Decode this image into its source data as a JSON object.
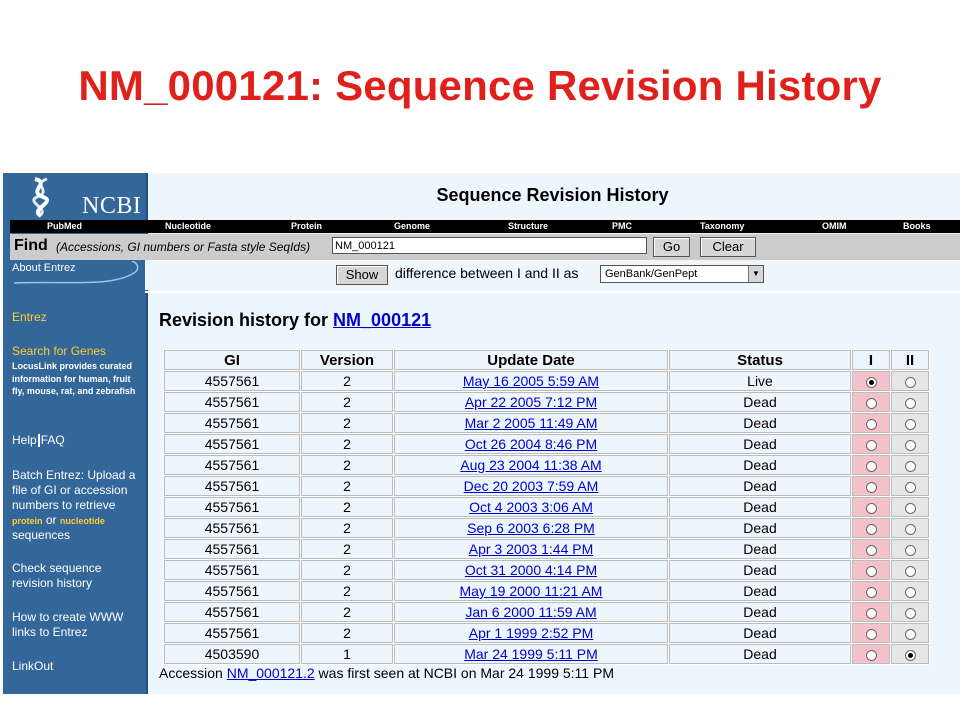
{
  "slide_title": "NM_000121: Sequence Revision History",
  "logo": {
    "text": "NCBI"
  },
  "page_heading": "Sequence Revision History",
  "nav": [
    "PubMed",
    "Nucleotide",
    "Protein",
    "Genome",
    "Structure",
    "PMC",
    "Taxonomy",
    "OMIM",
    "Books"
  ],
  "find": {
    "label": "Find",
    "hint": "(Accessions, GI numbers or Fasta style SeqIds)",
    "value": "NM_000121",
    "go_label": "Go",
    "clear_label": "Clear"
  },
  "diff": {
    "show_label": "Show",
    "text": "difference between I and II as",
    "format": "GenBank/GenPept"
  },
  "sidebar": {
    "about": "About Entrez",
    "entrez": "Entrez",
    "search_genes": "Search for Genes",
    "locuslink": "LocusLink provides curated information for human, fruit fly, mouse, rat, and zebrafish",
    "help": "Help",
    "faq": "FAQ",
    "batch_1": "Batch Entrez: Upload a file of GI or accession numbers to retrieve",
    "batch_protein": "protein",
    "batch_or": "or",
    "batch_nucleotide": "nucleotide",
    "batch_2": "sequences",
    "check": "Check sequence revision history",
    "howto": "How to create WWW links to Entrez",
    "linkout": "LinkOut"
  },
  "revision": {
    "heading_prefix": "Revision history for",
    "accession": "NM_000121"
  },
  "table": {
    "headers": [
      "GI",
      "Version",
      "Update Date",
      "Status",
      "I",
      "II"
    ],
    "rows": [
      {
        "gi": "4557561",
        "version": "2",
        "date": "May 16 2005 5:59 AM",
        "status": "Live",
        "sel_i": true,
        "sel_ii": false
      },
      {
        "gi": "4557561",
        "version": "2",
        "date": "Apr 22 2005 7:12 PM",
        "status": "Dead",
        "sel_i": false,
        "sel_ii": false
      },
      {
        "gi": "4557561",
        "version": "2",
        "date": "Mar 2 2005 11:49 AM",
        "status": "Dead",
        "sel_i": false,
        "sel_ii": false
      },
      {
        "gi": "4557561",
        "version": "2",
        "date": "Oct 26 2004 8:46 PM",
        "status": "Dead",
        "sel_i": false,
        "sel_ii": false
      },
      {
        "gi": "4557561",
        "version": "2",
        "date": "Aug 23 2004 11:38 AM",
        "status": "Dead",
        "sel_i": false,
        "sel_ii": false
      },
      {
        "gi": "4557561",
        "version": "2",
        "date": "Dec 20 2003 7:59 AM",
        "status": "Dead",
        "sel_i": false,
        "sel_ii": false
      },
      {
        "gi": "4557561",
        "version": "2",
        "date": "Oct 4 2003 3:06 AM",
        "status": "Dead",
        "sel_i": false,
        "sel_ii": false
      },
      {
        "gi": "4557561",
        "version": "2",
        "date": "Sep 6 2003 6:28 PM",
        "status": "Dead",
        "sel_i": false,
        "sel_ii": false
      },
      {
        "gi": "4557561",
        "version": "2",
        "date": "Apr 3 2003 1:44 PM",
        "status": "Dead",
        "sel_i": false,
        "sel_ii": false
      },
      {
        "gi": "4557561",
        "version": "2",
        "date": "Oct 31 2000 4:14 PM",
        "status": "Dead",
        "sel_i": false,
        "sel_ii": false
      },
      {
        "gi": "4557561",
        "version": "2",
        "date": "May 19 2000 11:21 AM",
        "status": "Dead",
        "sel_i": false,
        "sel_ii": false
      },
      {
        "gi": "4557561",
        "version": "2",
        "date": "Jan 6 2000 11:59 AM",
        "status": "Dead",
        "sel_i": false,
        "sel_ii": false
      },
      {
        "gi": "4557561",
        "version": "2",
        "date": "Apr 1 1999 2:52 PM",
        "status": "Dead",
        "sel_i": false,
        "sel_ii": false
      },
      {
        "gi": "4503590",
        "version": "1",
        "date": "Mar 24 1999 5:11 PM",
        "status": "Dead",
        "sel_i": false,
        "sel_ii": true
      }
    ]
  },
  "footer": {
    "prefix": "Accession",
    "accession": "NM_000121.2",
    "suffix": "was first seen at NCBI on Mar 24 1999 5:11 PM"
  }
}
